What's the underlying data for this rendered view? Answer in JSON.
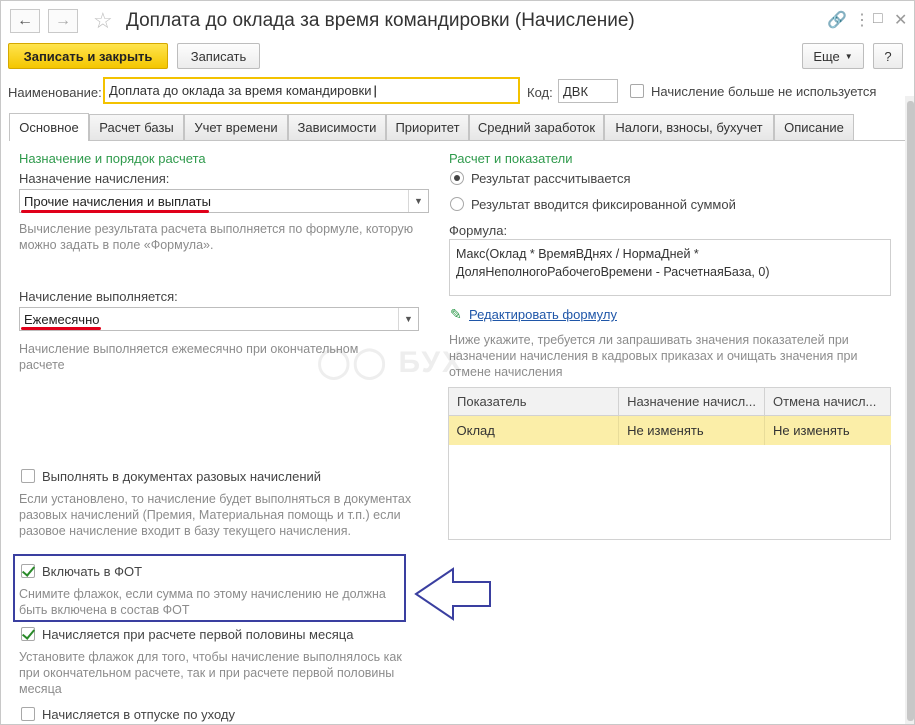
{
  "window": {
    "title": "Доплата до оклада за время командировки (Начисление)"
  },
  "toolbar": {
    "save_close_label": "Записать и закрыть",
    "save_label": "Записать",
    "more_label": "Еще",
    "help_label": "?"
  },
  "header": {
    "name_label": "Наименование:",
    "name_value": "Доплата до оклада за время командировки",
    "code_label": "Код:",
    "code_value": "ДВК",
    "unused_label": "Начисление больше не используется",
    "unused_checked": false
  },
  "tabs": [
    {
      "label": "Основное",
      "active": true
    },
    {
      "label": "Расчет базы",
      "active": false
    },
    {
      "label": "Учет времени",
      "active": false
    },
    {
      "label": "Зависимости",
      "active": false
    },
    {
      "label": "Приоритет",
      "active": false
    },
    {
      "label": "Средний заработок",
      "active": false
    },
    {
      "label": "Налоги, взносы, бухучет",
      "active": false
    },
    {
      "label": "Описание",
      "active": false
    }
  ],
  "left": {
    "section_title": "Назначение и порядок расчета",
    "purpose_label": "Назначение начисления:",
    "purpose_value": "Прочие начисления и выплаты",
    "purpose_hint": "Вычисление результата расчета выполняется по формуле, которую можно задать в поле «Формула».",
    "executed_label": "Начисление выполняется:",
    "executed_value": "Ежемесячно",
    "executed_hint": "Начисление выполняется ежемесячно при окончательном расчете",
    "one_time_label": "Выполнять в документах разовых начислений",
    "one_time_checked": false,
    "one_time_hint": "Если установлено, то начисление будет выполняться в документах разовых начислений (Премия, Материальная помощь и т.п.) если разовое начисление входит в базу текущего начисления.",
    "fot_label": "Включать в ФОТ",
    "fot_checked": true,
    "fot_hint": "Снимите флажок, если сумма по этому начислению не должна быть включена в состав ФОТ",
    "first_half_label": "Начисляется при расчете первой половины месяца",
    "first_half_checked": true,
    "first_half_hint": "Установите флажок для того, чтобы начисление выполнялось как при окончательном расчете, так и при расчете первой половины месяца",
    "leave_label": "Начисляется в отпуске по уходу",
    "leave_checked": false
  },
  "right": {
    "section_title": "Расчет и показатели",
    "radio_calculated": "Результат рассчитывается",
    "radio_fixed": "Результат вводится фиксированной суммой",
    "selected_radio": "calculated",
    "formula_label": "Формула:",
    "formula_line1": "Макс(Оклад * ВремяВДнях / НормаДней *",
    "formula_line2": "ДоляНеполногоРабочегоВремени - РасчетнаяБаза, 0)",
    "edit_formula_link": "Редактировать формулу",
    "indicators_hint": "Ниже укажите, требуется ли запрашивать значения показателей при назначении начисления в кадровых приказах и очищать значения при отмене начисления",
    "table_headers": [
      "Показатель",
      "Назначение начисл...",
      "Отмена начисл..."
    ],
    "table_rows": [
      [
        "Оклад",
        "Не изменять",
        "Не изменять"
      ]
    ]
  },
  "watermark_text": "БУХ",
  "colors": {
    "accent_yellow": "#f4c600",
    "section_green": "#2f9a4c",
    "annotation_red": "#e0001a",
    "annotation_blue": "#3a3fa0",
    "selected_row": "#fbeea8"
  }
}
